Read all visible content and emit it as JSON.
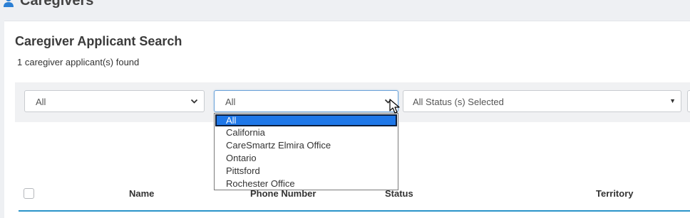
{
  "header": {
    "title": "Caregivers",
    "icon": "user-icon"
  },
  "search": {
    "title": "Caregiver Applicant Search",
    "result_count": "1 caregiver applicant(s) found"
  },
  "filters": {
    "filter1_value": "All",
    "filter2_value": "All",
    "status_value": "All Status (s) Selected"
  },
  "dropdown": {
    "options": [
      "All",
      "California",
      "CareSmartz Elmira Office",
      "Ontario",
      "Pittsford",
      "Rochester Office"
    ],
    "selected": "All"
  },
  "table": {
    "columns": [
      "Name",
      "Phone Number",
      "Status",
      "Territory"
    ]
  },
  "colors": {
    "accent": "#2a93c9",
    "selected_option": "#1e77e8"
  }
}
